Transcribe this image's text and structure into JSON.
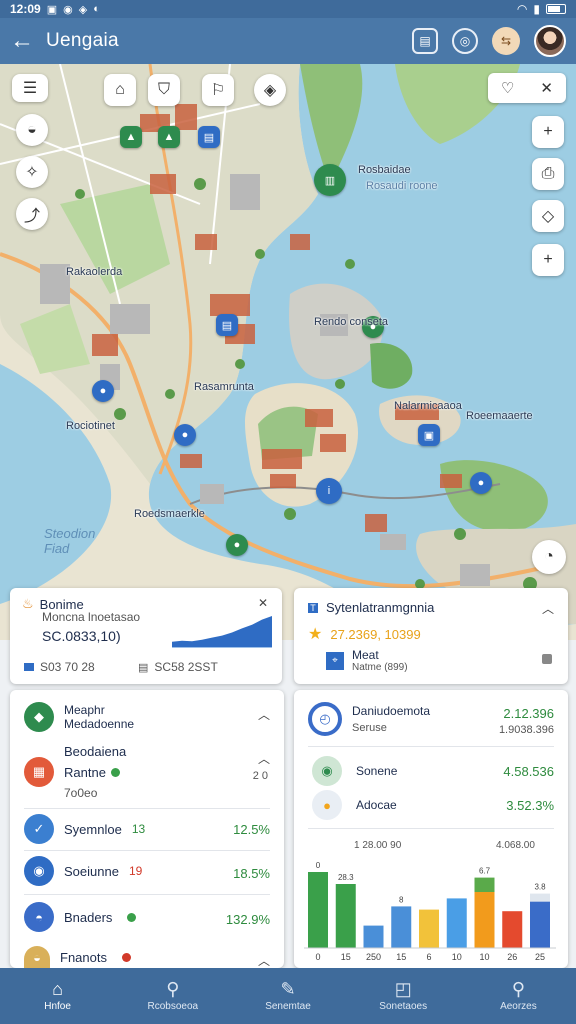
{
  "status": {
    "time": "12:09",
    "icons": [
      "▣",
      "◉",
      "◈",
      "◐"
    ]
  },
  "appbar": {
    "title": "Uengaia"
  },
  "map": {
    "labels": {
      "north": "Rosbaidae",
      "north_sub": "Rosaudi roone",
      "west": "Rakaolerda",
      "center": "Rendo conseta",
      "mid": "Rasamrunta",
      "island_right": "Nalarmicaaoa",
      "right": "Roeemaaerte",
      "south_west": "Roedsmaerkle",
      "left_mid": "Rociotinet",
      "water": "Steodion\nFiad"
    }
  },
  "card_route": {
    "title": "Bonime",
    "subtitle": "Moncna lnoetasao",
    "value": "SC.0833,10)",
    "foot1": "S03 70 28",
    "foot2": "SC58 2SST",
    "chart_values": [
      12,
      14,
      13,
      16,
      20,
      24,
      30,
      38,
      45,
      55,
      62
    ]
  },
  "card_system": {
    "title": "Sytenlatranmgnnia",
    "value": "27.2369, 10399",
    "item_title": "Meat",
    "item_sub": "Natme (899)"
  },
  "card_places": {
    "header_title": "Meaphr",
    "header_sub": "Medadoenne",
    "sub_header": "Beodaiena",
    "sub_row1": "Rantne",
    "sub_row1_val": "2 0",
    "sub_row2": "7o0eo",
    "items": [
      {
        "label": "Syemnloe",
        "tag": "13",
        "value": "12.5%"
      },
      {
        "label": "Soeiunne",
        "tag": "19",
        "value": "18.5%"
      },
      {
        "label": "Bnaders",
        "tag": "",
        "value": "132.9%"
      },
      {
        "label": "Fnanots",
        "tag": "",
        "value": ""
      }
    ]
  },
  "card_stats": {
    "title": "Daniudoemota",
    "subtitle": "Seruse",
    "title_value": "2.12.396",
    "title_sub": "1.9038.396",
    "rows": [
      {
        "label": "Sonene",
        "value": "4.58.536"
      },
      {
        "label": "Adocae",
        "value": "3.52.3%"
      }
    ]
  },
  "chart_data": {
    "type": "bar",
    "header_labels": [
      "1 28.00 90",
      "4.068.00"
    ],
    "categories": [
      "0",
      "15",
      "250",
      "15",
      "6",
      "10",
      "10",
      "26",
      "25"
    ],
    "values": [
      95,
      80,
      28,
      52,
      48,
      62,
      70,
      46,
      58
    ],
    "stack_top": [
      0,
      0,
      0,
      0,
      0,
      0,
      18,
      0,
      10
    ],
    "data_labels": [
      "0",
      "28.3",
      "",
      "8",
      "",
      "",
      "6.7",
      "",
      "3.8"
    ],
    "colors": [
      "#3aa04a",
      "#3aa04a",
      "#4a8fd8",
      "#4a8fd8",
      "#f2c23a",
      "#4a9ee6",
      "#f29b1c",
      "#e44a2e",
      "#3a6cc8"
    ]
  },
  "bottom_nav": [
    {
      "label": "Hnfoe",
      "icon": "⌂"
    },
    {
      "label": "Rcobsoeoa",
      "icon": "⚲"
    },
    {
      "label": "Senemtae",
      "icon": "✎"
    },
    {
      "label": "Sonetaoes",
      "icon": "◰"
    },
    {
      "label": "Aeorzes",
      "icon": "⚲"
    }
  ]
}
